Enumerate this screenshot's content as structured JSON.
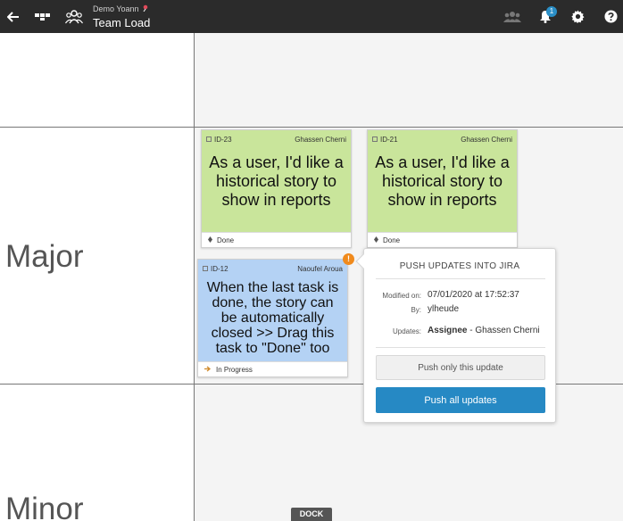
{
  "header": {
    "subtitle": "Demo Yoann",
    "title": "Team Load",
    "notification_count": "1",
    "icons": [
      "back-arrow-icon",
      "board-icon",
      "team-icon",
      "users-icon",
      "bell-icon",
      "gear-icon",
      "help-icon"
    ]
  },
  "lanes": [
    {
      "label": ""
    },
    {
      "label": "Major"
    },
    {
      "label": "Minor"
    }
  ],
  "cards": [
    {
      "id": "ID-23",
      "assignee": "Ghassen Cherni",
      "text": "As a user, I'd like a historical story to show in reports",
      "status": "Done",
      "color": "#c9e59b"
    },
    {
      "id": "ID-21",
      "assignee": "Ghassen Cherni",
      "text": "As a user, I'd like a historical story to show in reports",
      "status": "Done",
      "color": "#c9e59b"
    },
    {
      "id": "ID-12",
      "assignee": "Naoufel Aroua",
      "text": "When the last task is done, the story can be automatically closed >> Drag this task to \"Done\" too",
      "status": "In Progress",
      "color": "#b4d2f4"
    }
  ],
  "popup": {
    "title": "PUSH UPDATES INTO JIRA",
    "modified_on_label": "Modified on:",
    "modified_on_value": "07/01/2020 at 17:52:37",
    "by_label": "By:",
    "by_value": "ylheude",
    "updates_label": "Updates:",
    "updates_field": "Assignee",
    "updates_value": " - Ghassen Cherni",
    "push_one_label": "Push only this update",
    "push_all_label": "Push all updates"
  },
  "dock": {
    "label": "DOCK"
  },
  "colors": {
    "topbar": "#2b2b2b",
    "accent": "#2689c4",
    "alert": "#f08a1c"
  }
}
